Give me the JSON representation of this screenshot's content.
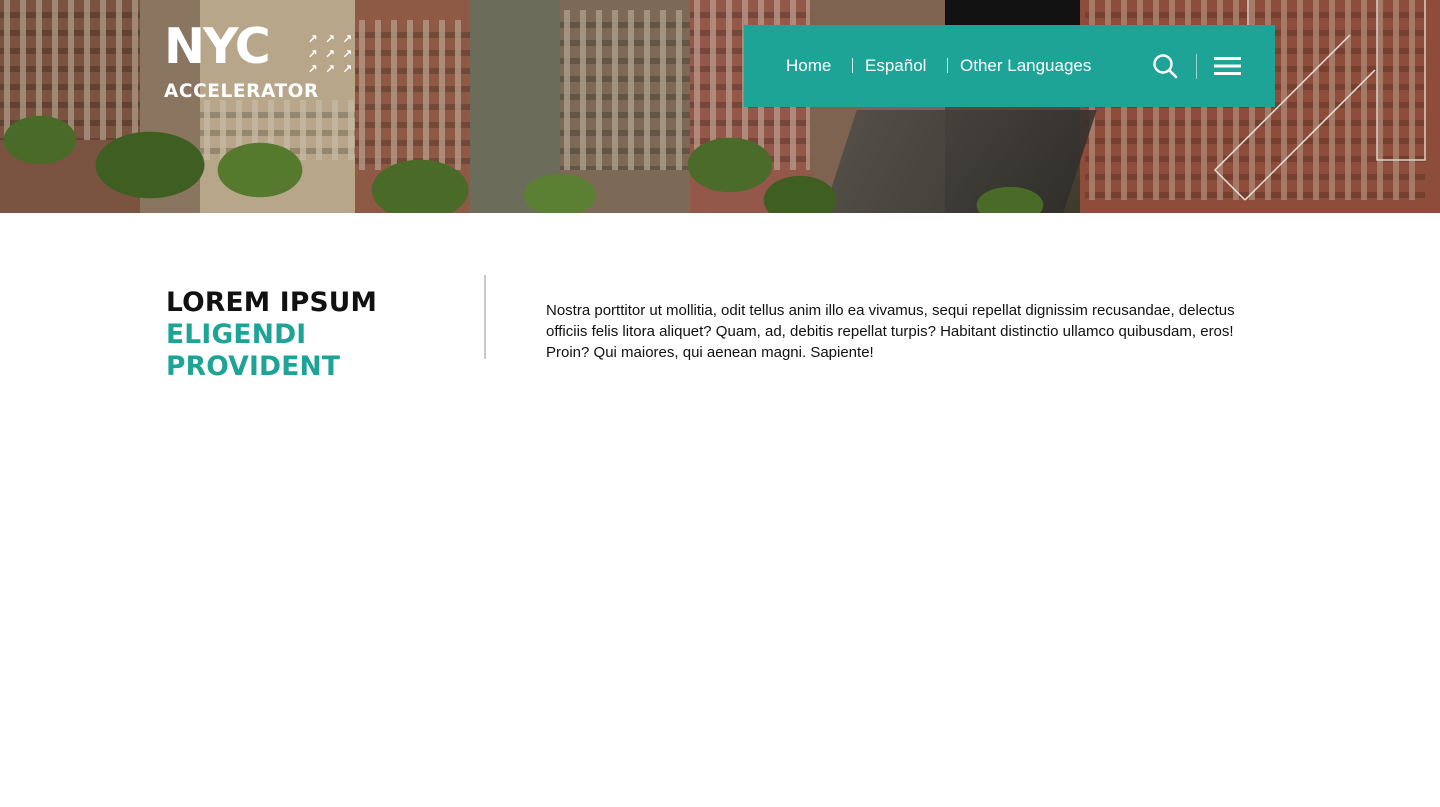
{
  "logo": {
    "mark": "NYC",
    "word": "ACCELERATOR",
    "arrow_glyphs": [
      "↗",
      "↗",
      "↗",
      "↗",
      "↗",
      "↗",
      "↗",
      "↗",
      "↗"
    ]
  },
  "nav": {
    "links": [
      {
        "label": "Home"
      },
      {
        "label": "Español"
      },
      {
        "label": "Other Languages"
      }
    ],
    "search_icon": "search-icon",
    "menu_icon": "hamburger-menu-icon",
    "bg_color": "#1ea397"
  },
  "content": {
    "headline": {
      "line1": "LOREM IPSUM",
      "line2": "ELIGENDI",
      "line3": "PROVIDENT"
    },
    "body": "Nostra porttitor ut mollitia, odit tellus anim illo ea vivamus, sequi repellat dignissim recusandae, delectus officiis felis litora aliquet? Quam, ad, debitis repellat turpis? Habitant distinctio ullamco quibusdam, eros! Proin? Qui maiores, qui aenean magni. Sapiente!"
  },
  "colors": {
    "accent": "#1ea397",
    "headline_dark": "#111111"
  }
}
